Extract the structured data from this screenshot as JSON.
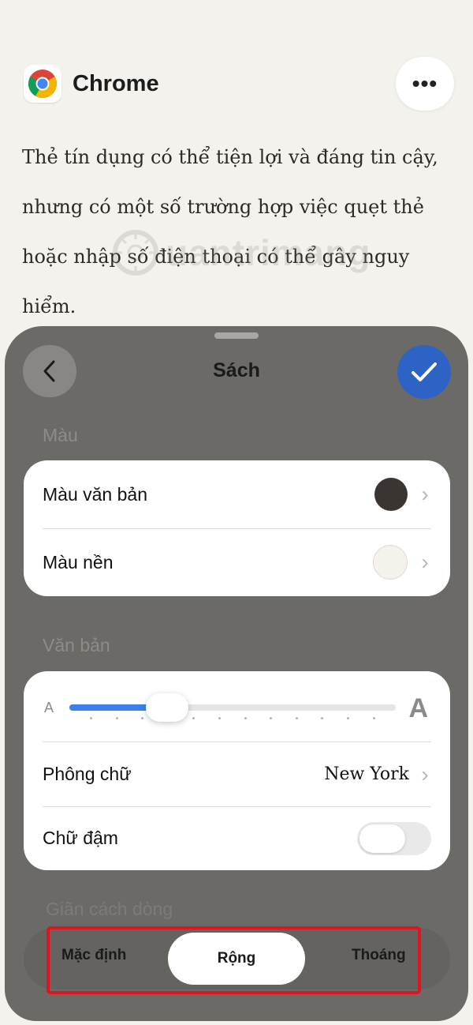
{
  "app": {
    "name": "Chrome",
    "icon": "chrome-logo-icon",
    "more_icon": "ellipsis-icon",
    "more_label": "•••"
  },
  "article": {
    "text": "Thẻ tín dụng có thể tiện lợi và đáng tin cậy, nhưng có một số trường hợp việc quẹt thẻ hoặc nhập số điện thoại có thể gây nguy hiểm."
  },
  "watermark": {
    "text": "uantrimang"
  },
  "sheet": {
    "title": "Sách",
    "back_icon": "chevron-left-icon",
    "confirm_icon": "checkmark-icon",
    "colors_section": "Màu",
    "text_color_label": "Màu văn bản",
    "text_color": "#3b3532",
    "bg_color_label": "Màu nền",
    "bg_color": "#f4f2ea",
    "text_section": "Văn bản",
    "size_small_label": "A",
    "size_large_label": "A",
    "text_size_level": 0.3,
    "font_label": "Phông chữ",
    "font_value": "New York",
    "bold_label": "Chữ đậm",
    "bold_enabled": false,
    "line_spacing_section": "Giãn cách dòng",
    "line_spacing_options": [
      "Mặc định",
      "Rộng",
      "Thoáng"
    ],
    "line_spacing_selected": "Rộng"
  },
  "colors": {
    "accent": "#2e63c6",
    "slider": "#3a82e8",
    "highlight": "#e0141e"
  }
}
